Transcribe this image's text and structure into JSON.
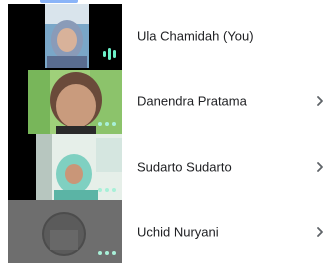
{
  "participants": [
    {
      "name": "Ula Chamidah (You)",
      "has_chevron": false
    },
    {
      "name": "Danendra Pratama",
      "has_chevron": true
    },
    {
      "name": "Sudarto Sudarto",
      "has_chevron": true
    },
    {
      "name": "Uchid Nuryani",
      "has_chevron": true
    }
  ],
  "colors": {
    "tile_bg": "#000000",
    "tile_bg_off": "#6e6e6e",
    "audio_indicator": "#6cf0c8",
    "more_dots": "#a8f0d8",
    "chevron": "#5f6368"
  },
  "icons": {
    "more": "more-options-icon",
    "chevron": "chevron-right-icon",
    "audio": "audio-level-icon"
  }
}
